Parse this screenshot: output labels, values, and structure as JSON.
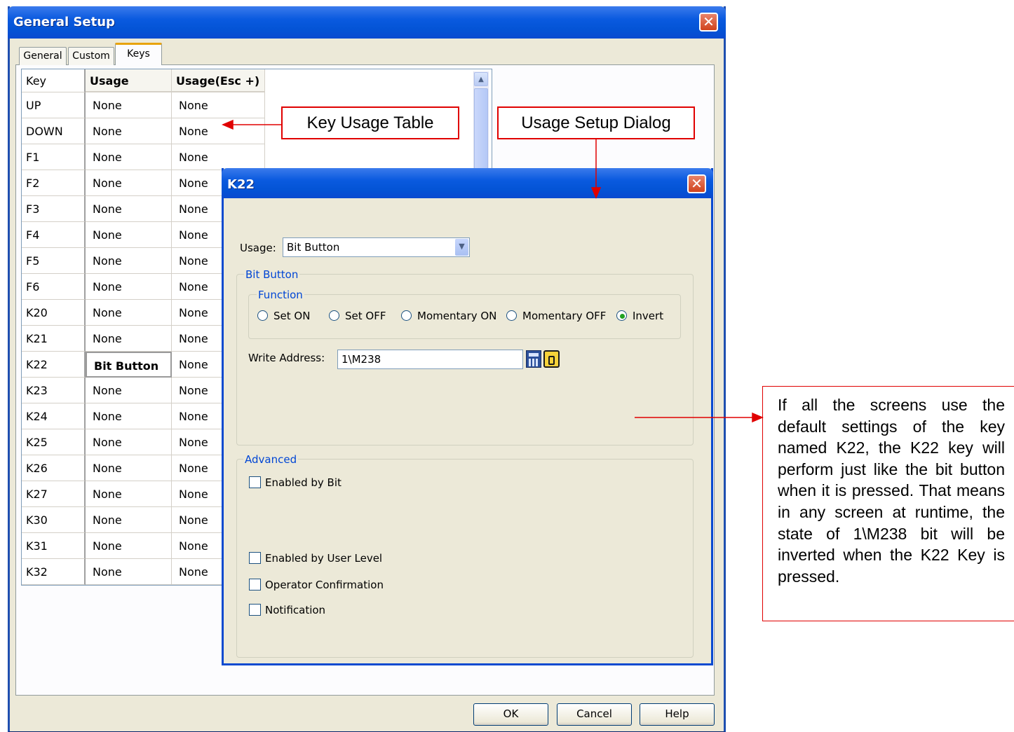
{
  "main_window": {
    "title": "General Setup",
    "close_glyph": "✕"
  },
  "tabs": [
    {
      "label": "General"
    },
    {
      "label": "Custom"
    },
    {
      "label": "Keys"
    }
  ],
  "key_table": {
    "headers": [
      "Key",
      "Usage",
      "Usage(Esc +)"
    ],
    "rows": [
      {
        "key": "UP",
        "usage": "None",
        "usage_esc": "None"
      },
      {
        "key": "DOWN",
        "usage": "None",
        "usage_esc": "None"
      },
      {
        "key": "F1",
        "usage": "None",
        "usage_esc": "None"
      },
      {
        "key": "F2",
        "usage": "None",
        "usage_esc": "None"
      },
      {
        "key": "F3",
        "usage": "None",
        "usage_esc": "None"
      },
      {
        "key": "F4",
        "usage": "None",
        "usage_esc": "None"
      },
      {
        "key": "F5",
        "usage": "None",
        "usage_esc": "None"
      },
      {
        "key": "F6",
        "usage": "None",
        "usage_esc": "None"
      },
      {
        "key": "K20",
        "usage": "None",
        "usage_esc": "None"
      },
      {
        "key": "K21",
        "usage": "None",
        "usage_esc": "None"
      },
      {
        "key": "K22",
        "usage": "Bit Button",
        "usage_esc": "None",
        "selected": true
      },
      {
        "key": "K23",
        "usage": "None",
        "usage_esc": "None"
      },
      {
        "key": "K24",
        "usage": "None",
        "usage_esc": "None"
      },
      {
        "key": "K25",
        "usage": "None",
        "usage_esc": "None"
      },
      {
        "key": "K26",
        "usage": "None",
        "usage_esc": "None"
      },
      {
        "key": "K27",
        "usage": "None",
        "usage_esc": "None"
      },
      {
        "key": "K30",
        "usage": "None",
        "usage_esc": "None"
      },
      {
        "key": "K31",
        "usage": "None",
        "usage_esc": "None"
      },
      {
        "key": "K32",
        "usage": "None",
        "usage_esc": "None"
      }
    ]
  },
  "annotations": {
    "key_usage_table": "Key Usage Table",
    "usage_setup_dialog": "Usage Setup Dialog",
    "note": "If all the screens use the default settings of the key named K22, the K22 key will perform just like the bit button when it is pressed. That means in any screen at runtime, the state of 1\\M238 bit will be inverted when the K22 Key is pressed."
  },
  "dialog": {
    "title": "K22",
    "usage_label": "Usage:",
    "usage_value": "Bit Button",
    "bit_button_group": "Bit Button",
    "function_group": "Function",
    "functions": [
      {
        "label": "Set ON",
        "checked": false
      },
      {
        "label": "Set OFF",
        "checked": false
      },
      {
        "label": "Momentary ON",
        "checked": false
      },
      {
        "label": "Momentary OFF",
        "checked": false
      },
      {
        "label": "Invert",
        "checked": true
      }
    ],
    "write_address_label": "Write Address:",
    "write_address_value": "1\\M238",
    "address_icons": [
      "calculator-icon",
      "tag-icon"
    ],
    "advanced_group": "Advanced",
    "options": [
      {
        "label": "Enabled by Bit",
        "checked": false
      },
      {
        "label": "Enabled by User Level",
        "checked": false
      },
      {
        "label": "Operator Confirmation",
        "checked": false
      },
      {
        "label": "Notification",
        "checked": false
      }
    ]
  },
  "buttons": {
    "ok": "OK",
    "cancel": "Cancel",
    "help": "Help"
  },
  "colors": {
    "title_bar": "#0a5adf",
    "annotation": "#e00000",
    "window_bg": "#ece9d8",
    "legend": "#0046d5"
  }
}
